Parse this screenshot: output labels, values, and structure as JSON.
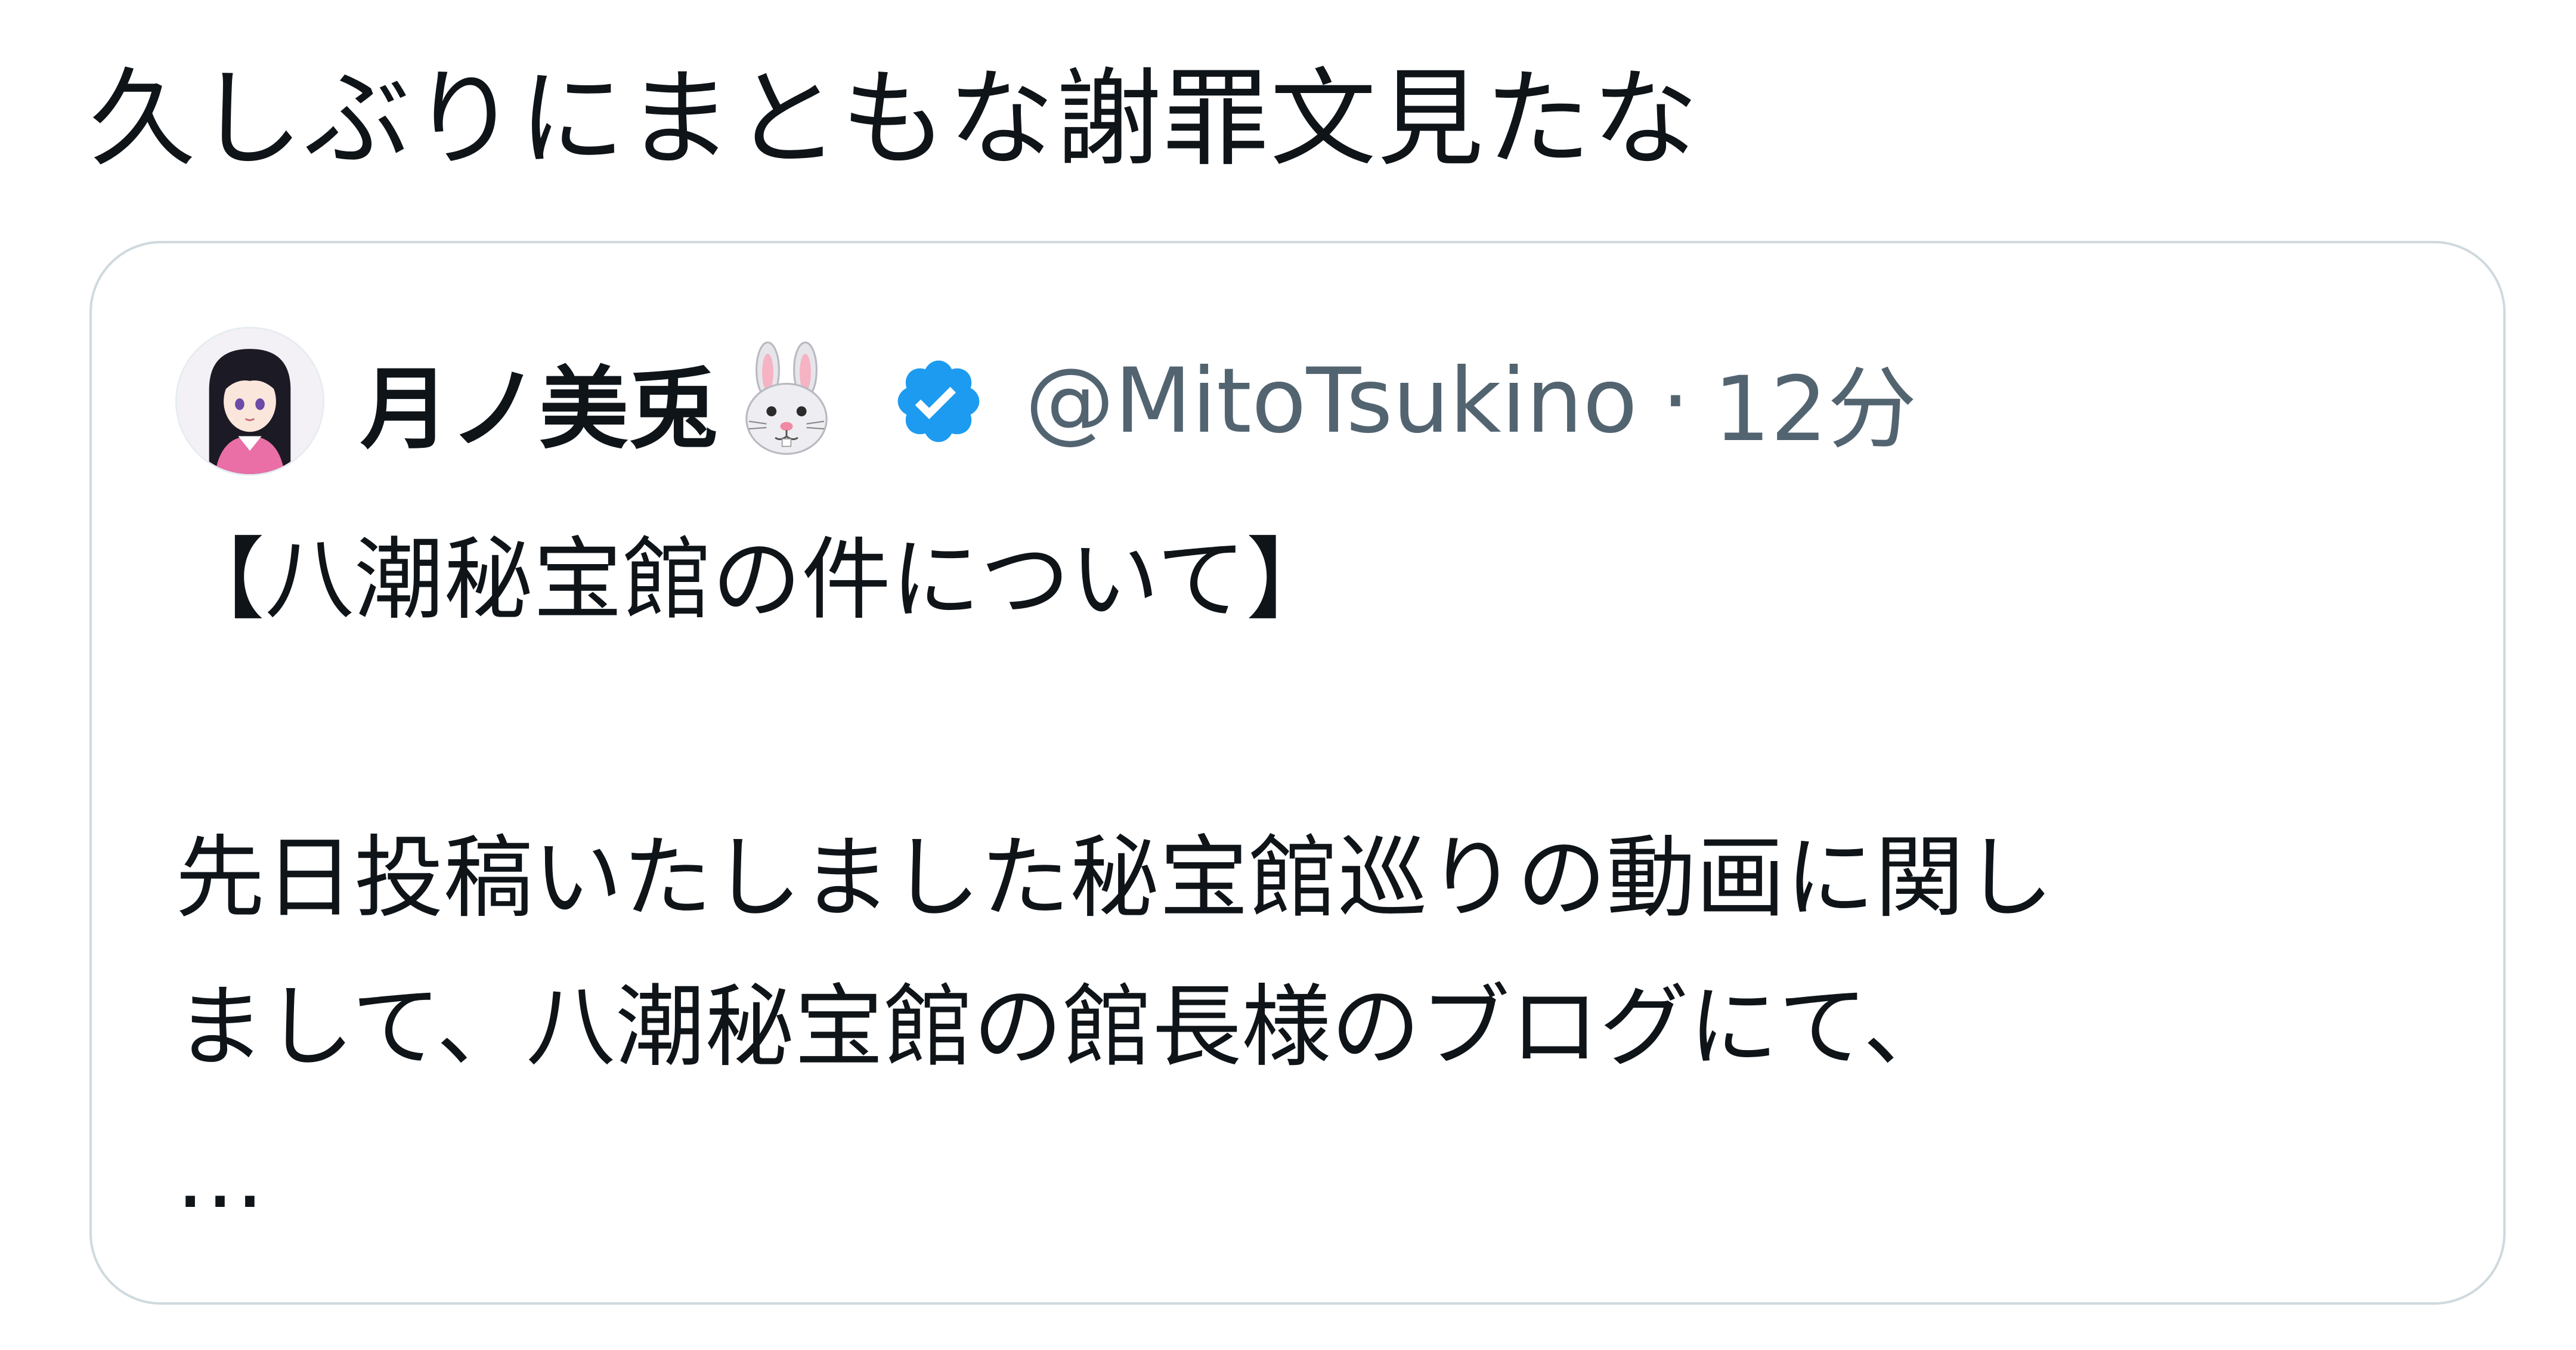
{
  "tweet": {
    "text": "久しぶりにまともな謝罪文見たな"
  },
  "quoted_tweet": {
    "display_name": "月ノ美兎",
    "name_emoji_icon": "rabbit-face-icon",
    "verified_icon": "verified-badge-icon",
    "handle": "@MitoTsukino",
    "separator": "·",
    "timestamp": "12分",
    "body": {
      "heading": "【八潮秘宝館の件について】",
      "line1": "先日投稿いたしました秘宝館巡りの動画に関し",
      "line2": "まして、八潮秘宝館の館長様のブログにて、",
      "truncation": "…"
    }
  },
  "colors": {
    "text_primary": "#0f1419",
    "text_secondary": "#536471",
    "card_border": "#cfd9de",
    "verified_blue": "#1d9bf0"
  }
}
